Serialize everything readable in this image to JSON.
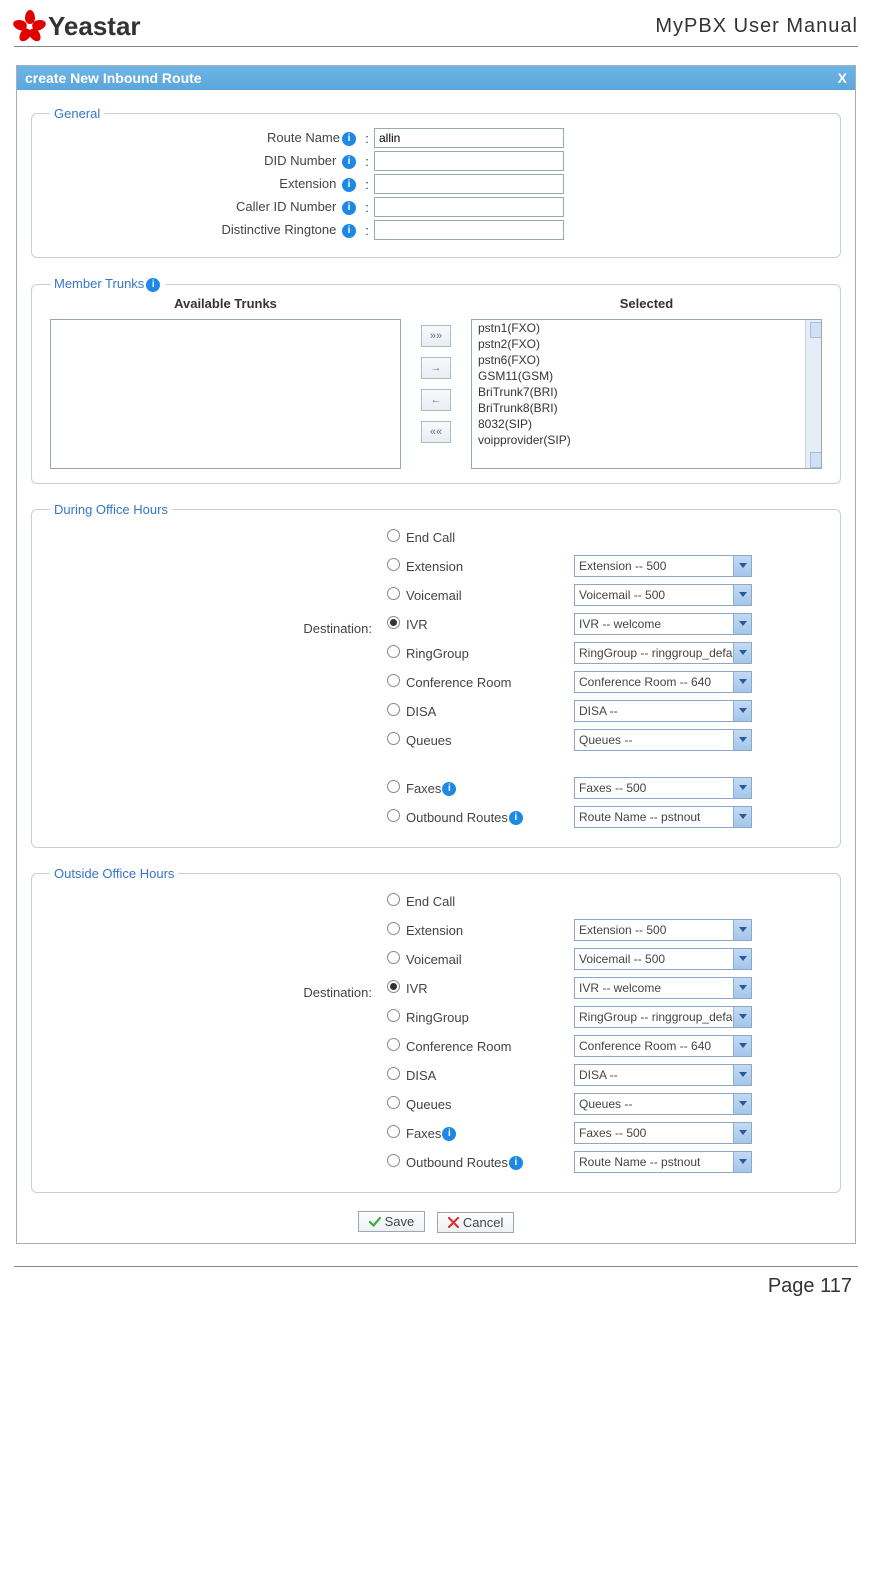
{
  "doc": {
    "brand": "Yeastar",
    "title": "MyPBX  User  Manual",
    "page_label": "Page 117"
  },
  "dialog": {
    "title": "create New Inbound Route",
    "close": "X"
  },
  "sections": {
    "general": {
      "legend": "General",
      "route_name_label": "Route Name",
      "route_name_value": "allin",
      "did_number_label": "DID Number",
      "did_number_value": "",
      "extension_label": "Extension",
      "extension_value": "",
      "caller_id_label": "Caller ID Number",
      "caller_id_value": "",
      "ringtone_label": "Distinctive Ringtone",
      "ringtone_value": "",
      "colon": ":"
    },
    "member_trunks": {
      "legend": "Member Trunks",
      "available_title": "Available Trunks",
      "selected_title": "Selected",
      "available_items": [],
      "selected_items": [
        "pstn1(FXO)",
        "pstn2(FXO)",
        "pstn6(FXO)",
        "GSM11(GSM)",
        "BriTrunk7(BRI)",
        "BriTrunk8(BRI)",
        "8032(SIP)",
        "voipprovider(SIP)"
      ],
      "movers": {
        "all_right": "»»",
        "right": "→",
        "left": "←",
        "all_left": "««"
      }
    },
    "during": {
      "legend": "During Office Hours",
      "destination_label": "Destination:",
      "rows": [
        {
          "key": "end_call",
          "label": "End Call",
          "checked": false,
          "select": null
        },
        {
          "key": "extension",
          "label": "Extension",
          "checked": false,
          "select": "Extension -- 500"
        },
        {
          "key": "voicemail",
          "label": "Voicemail",
          "checked": false,
          "select": "Voicemail -- 500"
        },
        {
          "key": "ivr",
          "label": "IVR",
          "checked": true,
          "select": "IVR -- welcome"
        },
        {
          "key": "ringgroup",
          "label": "RingGroup",
          "checked": false,
          "select": "RingGroup -- ringgroup_defa"
        },
        {
          "key": "confroom",
          "label": "Conference Room",
          "checked": false,
          "select": "Conference Room -- 640"
        },
        {
          "key": "disa",
          "label": "DISA",
          "checked": false,
          "select": "DISA --"
        },
        {
          "key": "queues",
          "label": "Queues",
          "checked": false,
          "select": "Queues --"
        }
      ],
      "extra_rows": [
        {
          "key": "faxes",
          "label": "Faxes",
          "checked": false,
          "select": "Faxes -- 500",
          "info": true
        },
        {
          "key": "outbound",
          "label": "Outbound Routes",
          "checked": false,
          "select": "Route Name -- pstnout",
          "info": true
        }
      ]
    },
    "outside": {
      "legend": "Outside Office Hours",
      "destination_label": "Destination:",
      "rows": [
        {
          "key": "end_call",
          "label": "End Call",
          "checked": false,
          "select": null
        },
        {
          "key": "extension",
          "label": "Extension",
          "checked": false,
          "select": "Extension -- 500"
        },
        {
          "key": "voicemail",
          "label": "Voicemail",
          "checked": false,
          "select": "Voicemail -- 500"
        },
        {
          "key": "ivr",
          "label": "IVR",
          "checked": true,
          "select": "IVR -- welcome"
        },
        {
          "key": "ringgroup",
          "label": "RingGroup",
          "checked": false,
          "select": "RingGroup -- ringgroup_defa"
        },
        {
          "key": "confroom",
          "label": "Conference Room",
          "checked": false,
          "select": "Conference Room -- 640"
        },
        {
          "key": "disa",
          "label": "DISA",
          "checked": false,
          "select": "DISA --"
        },
        {
          "key": "queues",
          "label": "Queues",
          "checked": false,
          "select": "Queues --"
        },
        {
          "key": "faxes",
          "label": "Faxes",
          "checked": false,
          "select": "Faxes -- 500",
          "info": true
        },
        {
          "key": "outbound",
          "label": "Outbound Routes",
          "checked": false,
          "select": "Route Name -- pstnout",
          "info": true
        }
      ]
    }
  },
  "footer_buttons": {
    "save": "Save",
    "cancel": "Cancel"
  },
  "icons": {
    "info": "i",
    "chevron_down": "▾",
    "check": "✓",
    "cross": "✕",
    "scroll_up": "▴",
    "scroll_down": "▾"
  }
}
